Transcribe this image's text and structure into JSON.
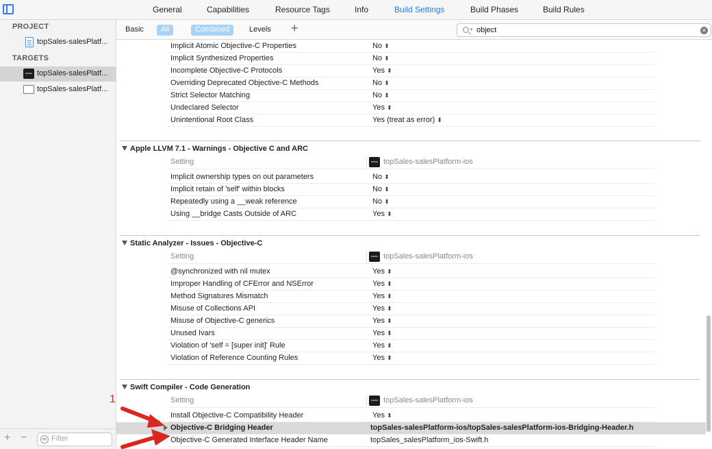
{
  "tabs": [
    "General",
    "Capabilities",
    "Resource Tags",
    "Info",
    "Build Settings",
    "Build Phases",
    "Build Rules"
  ],
  "active_tab": "Build Settings",
  "navigator": {
    "project_heading": "PROJECT",
    "project_item": "topSales-salesPlatf...",
    "targets_heading": "TARGETS",
    "target_items": [
      "topSales-salesPlatf...",
      "topSales-salesPlatf..."
    ],
    "filter_placeholder": "Filter"
  },
  "toolbar": {
    "basic": "Basic",
    "all": "All",
    "combined": "Combined",
    "levels": "Levels",
    "search_value": "object"
  },
  "sections": {
    "top_rows": [
      {
        "name": "Implicit Atomic Objective-C Properties",
        "value": "No"
      },
      {
        "name": "Implicit Synthesized Properties",
        "value": "No"
      },
      {
        "name": "Incomplete Objective-C Protocols",
        "value": "Yes"
      },
      {
        "name": "Overriding Deprecated Objective-C Methods",
        "value": "No"
      },
      {
        "name": "Strict Selector Matching",
        "value": "No"
      },
      {
        "name": "Undeclared Selector",
        "value": "Yes"
      },
      {
        "name": "Unintentional Root Class",
        "value": "Yes (treat as error)"
      }
    ],
    "arc": {
      "title": "Apple LLVM 7.1 - Warnings - Objective C and ARC",
      "setting_label": "Setting",
      "target_name": "topSales-salesPlatform-ios",
      "rows": [
        {
          "name": "Implicit ownership types on out parameters",
          "value": "No"
        },
        {
          "name": "Implicit retain of 'self' within blocks",
          "value": "No"
        },
        {
          "name": "Repeatedly using a __weak reference",
          "value": "No"
        },
        {
          "name": "Using __bridge Casts Outside of ARC",
          "value": "Yes"
        }
      ]
    },
    "analyzer": {
      "title": "Static Analyzer - Issues - Objective-C",
      "setting_label": "Setting",
      "target_name": "topSales-salesPlatform-ios",
      "rows": [
        {
          "name": "@synchronized with nil mutex",
          "value": "Yes"
        },
        {
          "name": "Improper Handling of CFError and NSError",
          "value": "Yes"
        },
        {
          "name": "Method Signatures Mismatch",
          "value": "Yes"
        },
        {
          "name": "Misuse of Collections API",
          "value": "Yes"
        },
        {
          "name": "Misuse of Objective-C generics",
          "value": "Yes"
        },
        {
          "name": "Unused Ivars",
          "value": "Yes"
        },
        {
          "name": "Violation of 'self = [super init]' Rule",
          "value": "Yes"
        },
        {
          "name": "Violation of Reference Counting Rules",
          "value": "Yes"
        }
      ]
    },
    "swift": {
      "title": "Swift Compiler - Code Generation",
      "setting_label": "Setting",
      "target_name": "topSales-salesPlatform-ios",
      "row_install": {
        "name": "Install Objective-C Compatibility Header",
        "value": "Yes"
      },
      "row_bridging": {
        "name": "Objective-C Bridging Header",
        "value": "topSales-salesPlatform-ios/topSales-salesPlatform-ios-Bridging-Header.h"
      },
      "row_generated": {
        "name": "Objective-C Generated Interface Header Name",
        "value": "topSales_salesPlatform_ios-Swift.h"
      }
    }
  },
  "annotation_number": "1",
  "colors": {
    "accent": "#1b7cf0",
    "annotation": "#d9281f",
    "highlight": "#d9d9d9"
  },
  "icons": {
    "stepper": "up-down-chevron",
    "clear": "clear-circle-icon",
    "search": "search-icon"
  }
}
